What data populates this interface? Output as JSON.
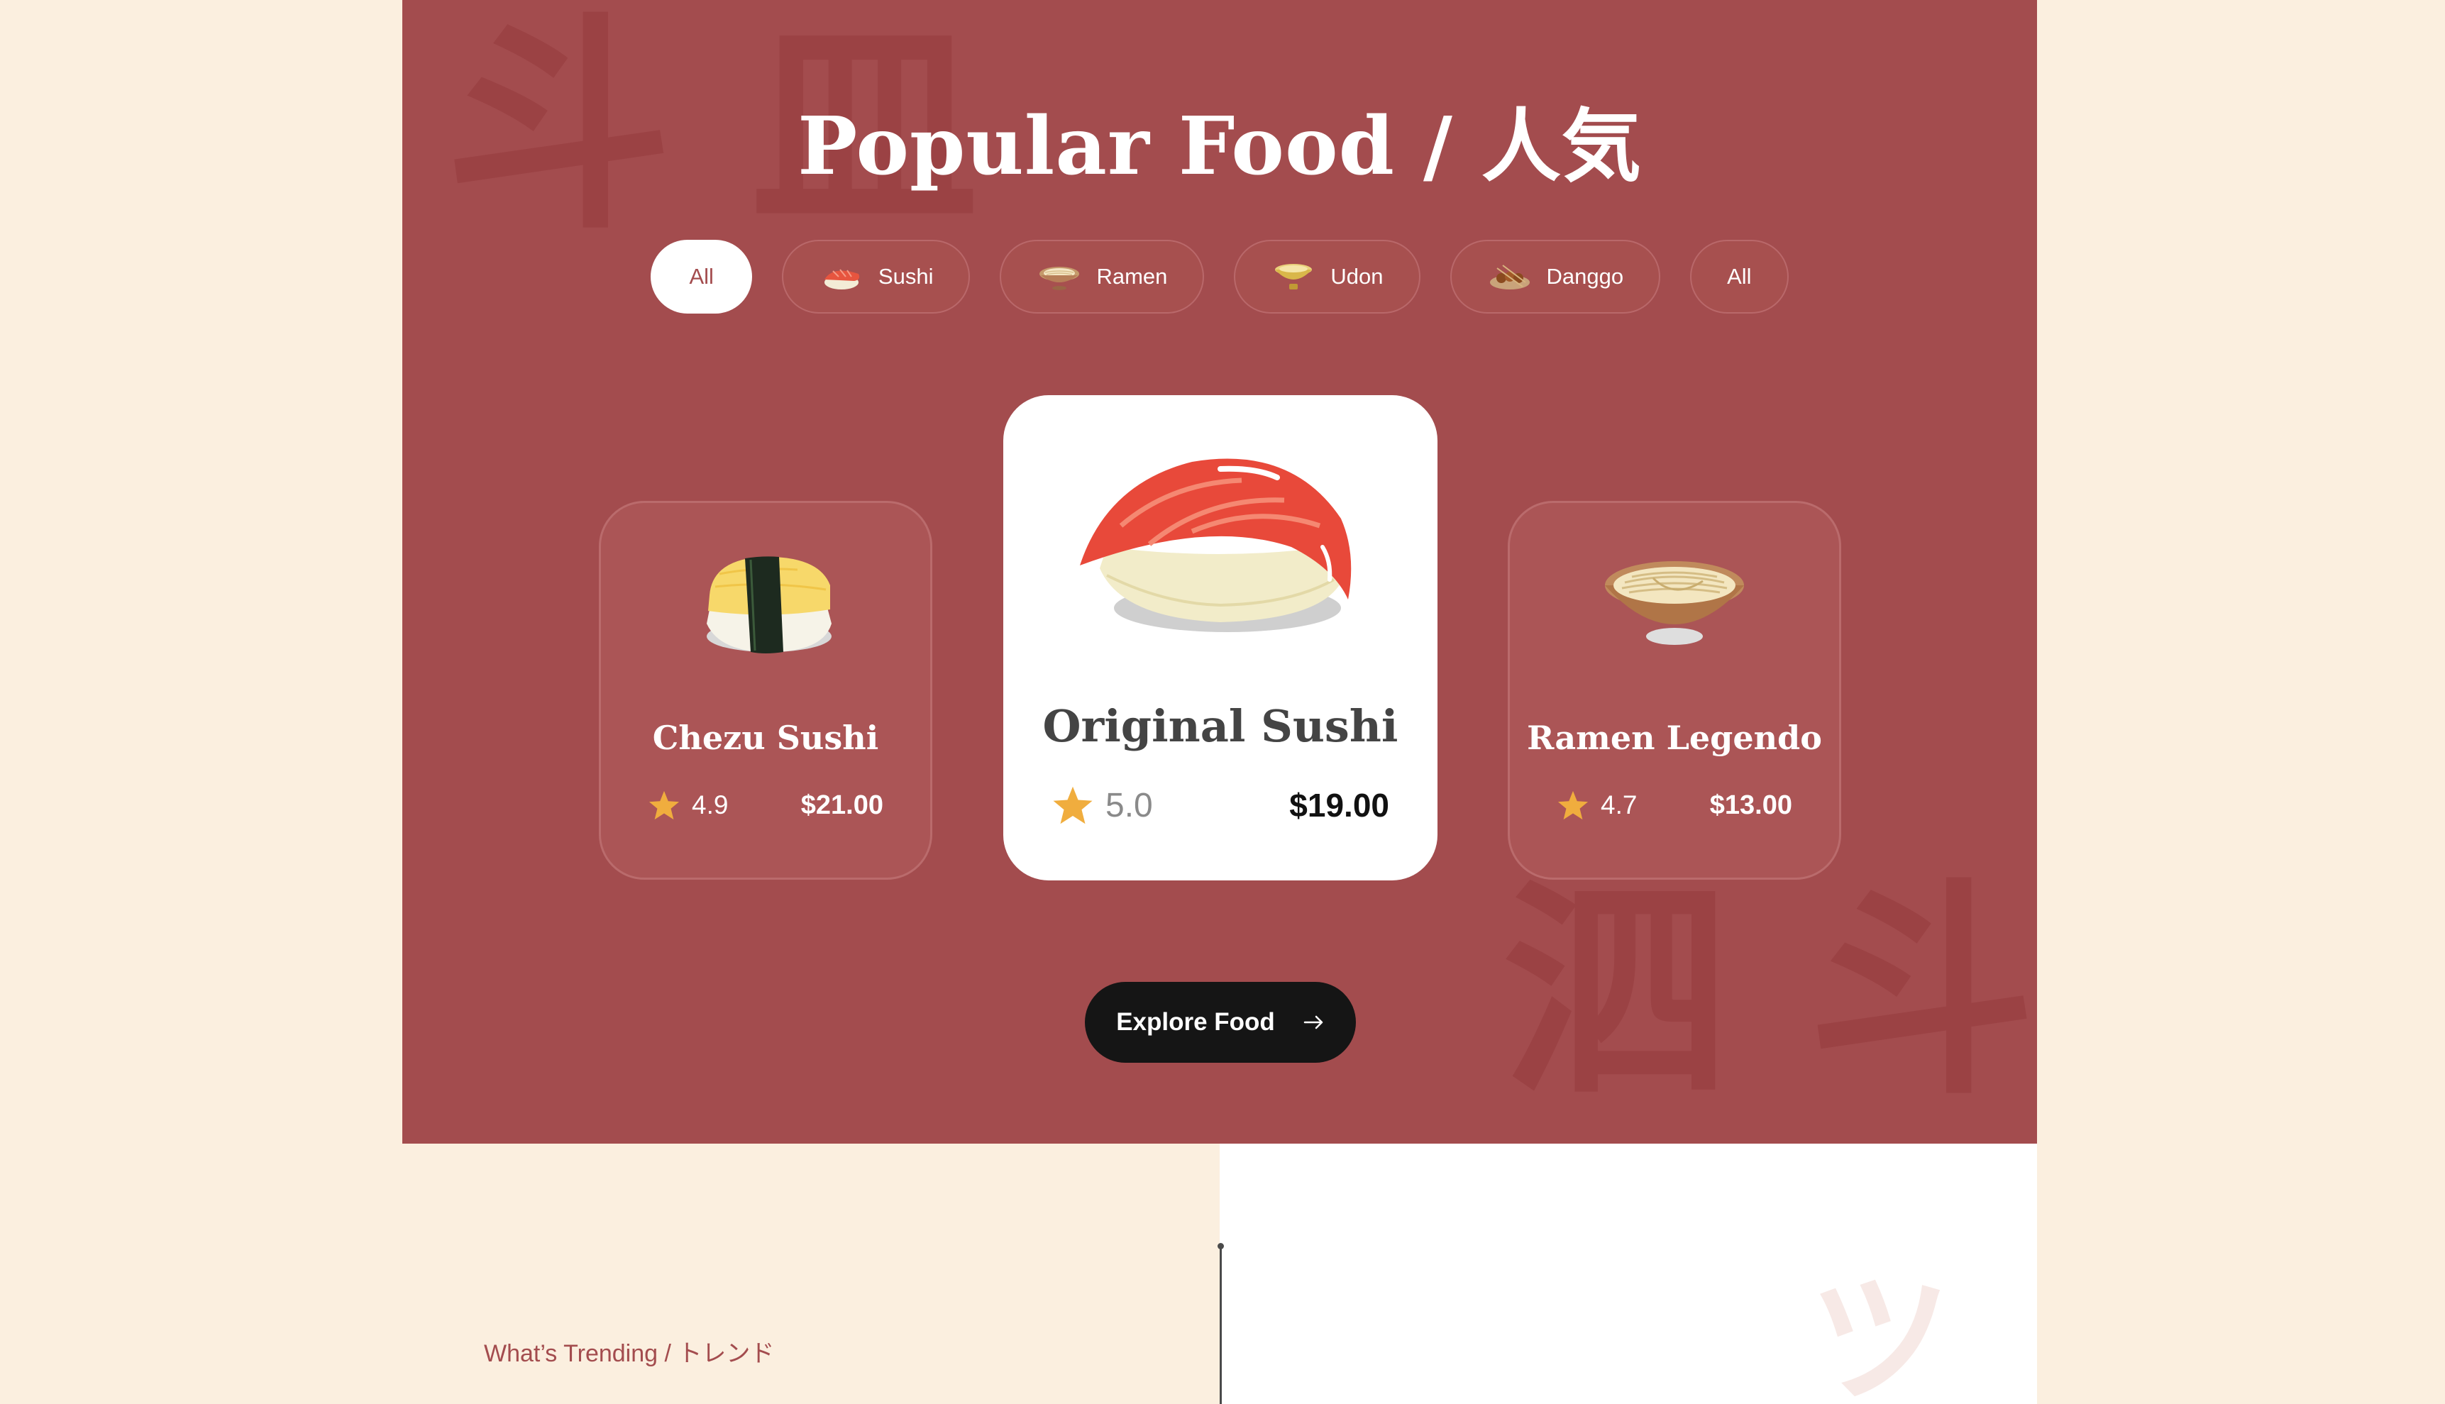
{
  "hero": {
    "title": "Popular Food / 人気",
    "deco_chars_1": "斗 皿",
    "deco_chars_2": "泗 斗",
    "tabs": [
      {
        "label": "All",
        "active": true,
        "icon": ""
      },
      {
        "label": "Sushi",
        "active": false,
        "icon": "sushi-icon"
      },
      {
        "label": "Ramen",
        "active": false,
        "icon": "ramen-icon"
      },
      {
        "label": "Udon",
        "active": false,
        "icon": "udon-icon"
      },
      {
        "label": "Danggo",
        "active": false,
        "icon": "danggo-icon"
      },
      {
        "label": "All",
        "active": false,
        "icon": ""
      }
    ],
    "cards": [
      {
        "name": "Chezu Sushi",
        "rating": "4.9",
        "price": "$21.00",
        "image": "tamago-sushi-image"
      },
      {
        "name": "Original Sushi",
        "rating": "5.0",
        "price": "$19.00",
        "image": "salmon-sushi-image"
      },
      {
        "name": "Ramen Legendo",
        "rating": "4.7",
        "price": "$13.00",
        "image": "ramen-bowl-image"
      }
    ],
    "explore_label": "Explore Food"
  },
  "trending": {
    "label": "What’s Trending / トレンド",
    "deco_char": "ツ"
  },
  "colors": {
    "brand_red": "#a34c4e",
    "cream": "#fbefdf",
    "star": "#f0ad3e",
    "dark_button": "#151515"
  }
}
